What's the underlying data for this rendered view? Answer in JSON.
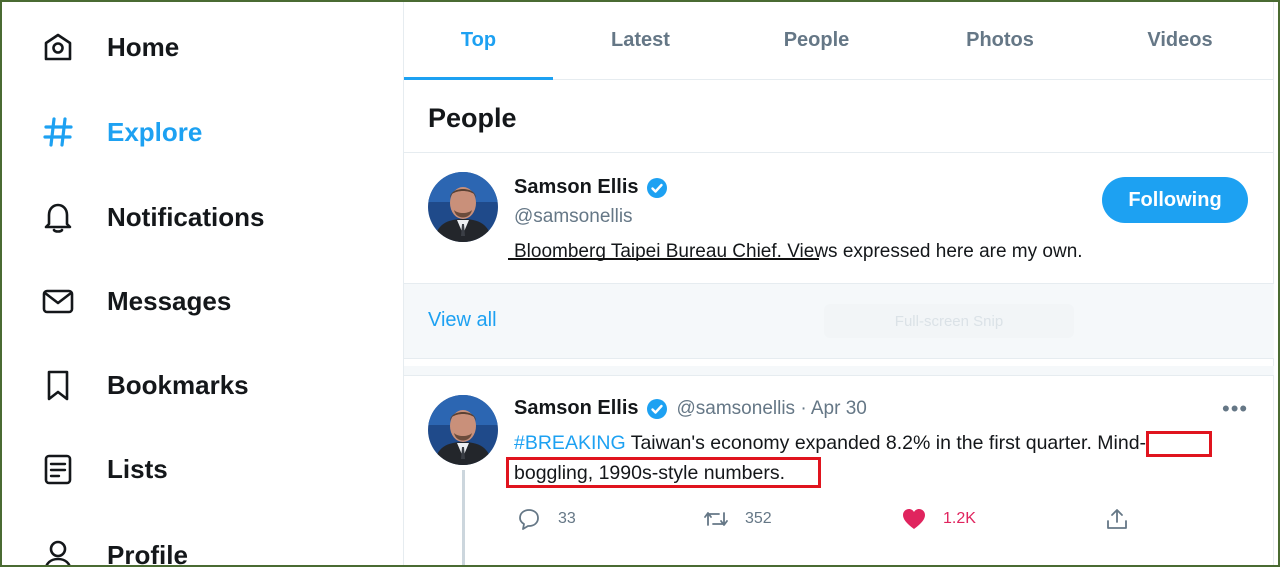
{
  "sidebar": {
    "items": [
      {
        "label": "Home",
        "icon": "home-icon"
      },
      {
        "label": "Explore",
        "icon": "hashtag-icon"
      },
      {
        "label": "Notifications",
        "icon": "bell-icon"
      },
      {
        "label": "Messages",
        "icon": "envelope-icon"
      },
      {
        "label": "Bookmarks",
        "icon": "bookmark-icon"
      },
      {
        "label": "Lists",
        "icon": "list-icon"
      },
      {
        "label": "Profile",
        "icon": "profile-icon"
      }
    ],
    "active": "Explore"
  },
  "tabs": [
    {
      "label": "Top",
      "active": true
    },
    {
      "label": "Latest"
    },
    {
      "label": "People"
    },
    {
      "label": "Photos"
    },
    {
      "label": "Videos"
    }
  ],
  "people_section": {
    "title": "People",
    "user": {
      "name": "Samson Ellis",
      "handle": "@samsonellis",
      "bio": "Bloomberg Taipei Bureau Chief. Views expressed here are my own.",
      "follow_button": "Following"
    },
    "view_all": "View all",
    "overlay_text": "Full-screen Snip"
  },
  "tweet": {
    "name": "Samson Ellis",
    "meta": "@samsonellis · Apr 30",
    "hashtag": "#BREAKING",
    "text_line1": "Taiwan's economy expanded 8.2% in the first quarter. Mind-",
    "text_line2": "boggling, 1990s-style numbers.",
    "replies": "33",
    "retweets": "352",
    "likes": "1.2K"
  },
  "colors": {
    "accent": "#1da1f2",
    "like": "#e0245e",
    "highlight_box": "#e0141e",
    "frame": "#4a6b32"
  }
}
